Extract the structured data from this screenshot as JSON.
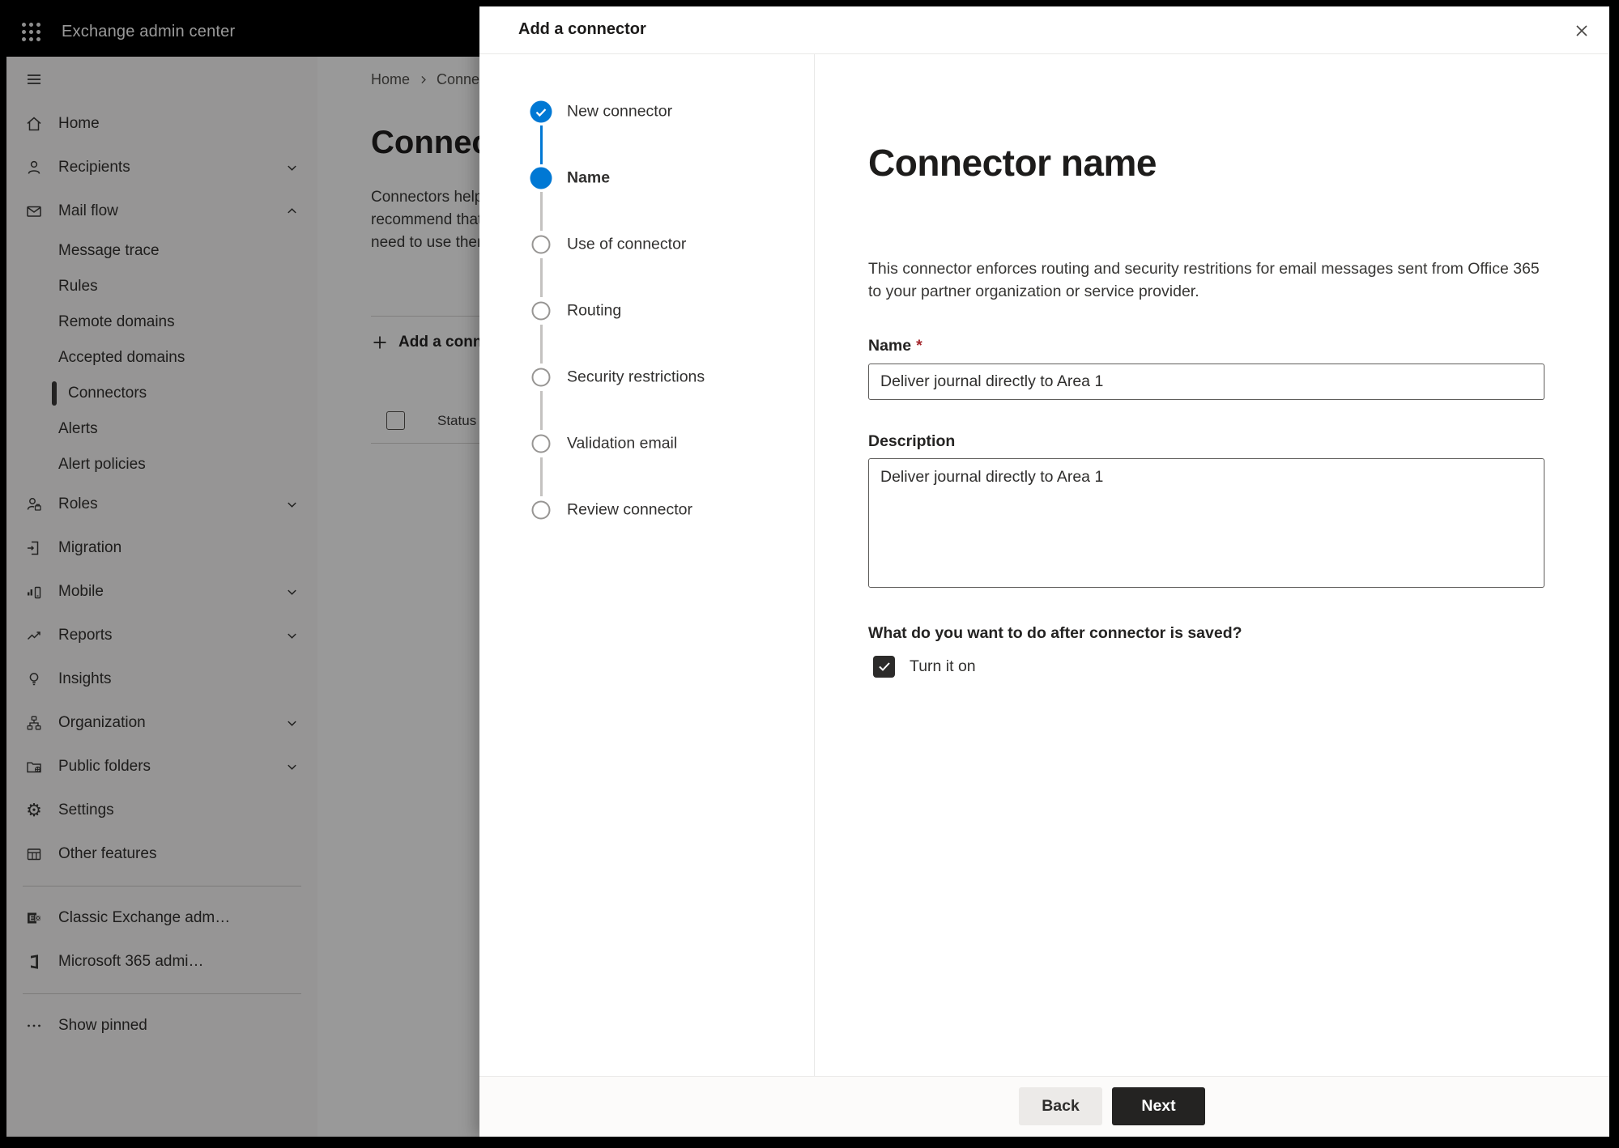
{
  "topbar": {
    "title": "Exchange admin center"
  },
  "sidebar": {
    "items": [
      {
        "label": "Home",
        "icon": "home-icon"
      },
      {
        "label": "Recipients",
        "icon": "person-icon",
        "chevron": "down"
      },
      {
        "label": "Mail flow",
        "icon": "mail-icon",
        "chevron": "up",
        "expanded": true
      },
      {
        "label": "Message trace",
        "type": "sub"
      },
      {
        "label": "Rules",
        "type": "sub"
      },
      {
        "label": "Remote domains",
        "type": "sub"
      },
      {
        "label": "Accepted domains",
        "type": "sub"
      },
      {
        "label": "Connectors",
        "type": "sub",
        "selected": true
      },
      {
        "label": "Alerts",
        "type": "sub"
      },
      {
        "label": "Alert policies",
        "type": "sub"
      },
      {
        "label": "Roles",
        "icon": "roles-icon",
        "chevron": "down"
      },
      {
        "label": "Migration",
        "icon": "migration-icon"
      },
      {
        "label": "Mobile",
        "icon": "mobile-icon",
        "chevron": "down"
      },
      {
        "label": "Reports",
        "icon": "reports-icon",
        "chevron": "down"
      },
      {
        "label": "Insights",
        "icon": "insights-icon"
      },
      {
        "label": "Organization",
        "icon": "organization-icon",
        "chevron": "down"
      },
      {
        "label": "Public folders",
        "icon": "public-folders-icon",
        "chevron": "down"
      },
      {
        "label": "Settings",
        "icon": "settings-gear-icon"
      },
      {
        "label": "Other features",
        "icon": "other-features-icon"
      },
      {
        "label": "Classic Exchange adm…",
        "icon": "exchange-logo-icon"
      },
      {
        "label": "Microsoft 365 admi…",
        "icon": "microsoft-365-logo-icon"
      },
      {
        "label": "Show pinned",
        "icon": "more-ellipsis-icon"
      }
    ]
  },
  "page": {
    "breadcrumb": {
      "home": "Home",
      "current": "Conne"
    },
    "title": "Connec",
    "intro_lines": [
      "Connectors help",
      "recommend that",
      "need to use ther"
    ],
    "add_connector_label": "Add a conn",
    "status_header": "Status"
  },
  "modal": {
    "title": "Add a connector",
    "wizard": {
      "steps": [
        {
          "label": "New connector",
          "state": "completed"
        },
        {
          "label": "Name",
          "state": "active"
        },
        {
          "label": "Use of connector",
          "state": "upcoming"
        },
        {
          "label": "Routing",
          "state": "upcoming"
        },
        {
          "label": "Security restrictions",
          "state": "upcoming"
        },
        {
          "label": "Validation email",
          "state": "upcoming"
        },
        {
          "label": "Review connector",
          "state": "upcoming"
        }
      ]
    },
    "content": {
      "heading": "Connector name",
      "description": "This connector enforces routing and security restritions for email messages sent from Office 365 to your partner organization or service provider.",
      "name_label": "Name",
      "required_marker": "*",
      "name_value": "Deliver journal directly to Area 1",
      "description_label": "Description",
      "description_value": "Deliver journal directly to Area 1",
      "after_save_question": "What do you want to do after connector is saved?",
      "turn_it_on_label": "Turn it on",
      "turn_it_on_checked": true
    },
    "footer": {
      "back_label": "Back",
      "next_label": "Next"
    }
  },
  "colors": {
    "accent": "#0078d4",
    "danger": "#a4262c",
    "next_button_bg": "#242322"
  }
}
